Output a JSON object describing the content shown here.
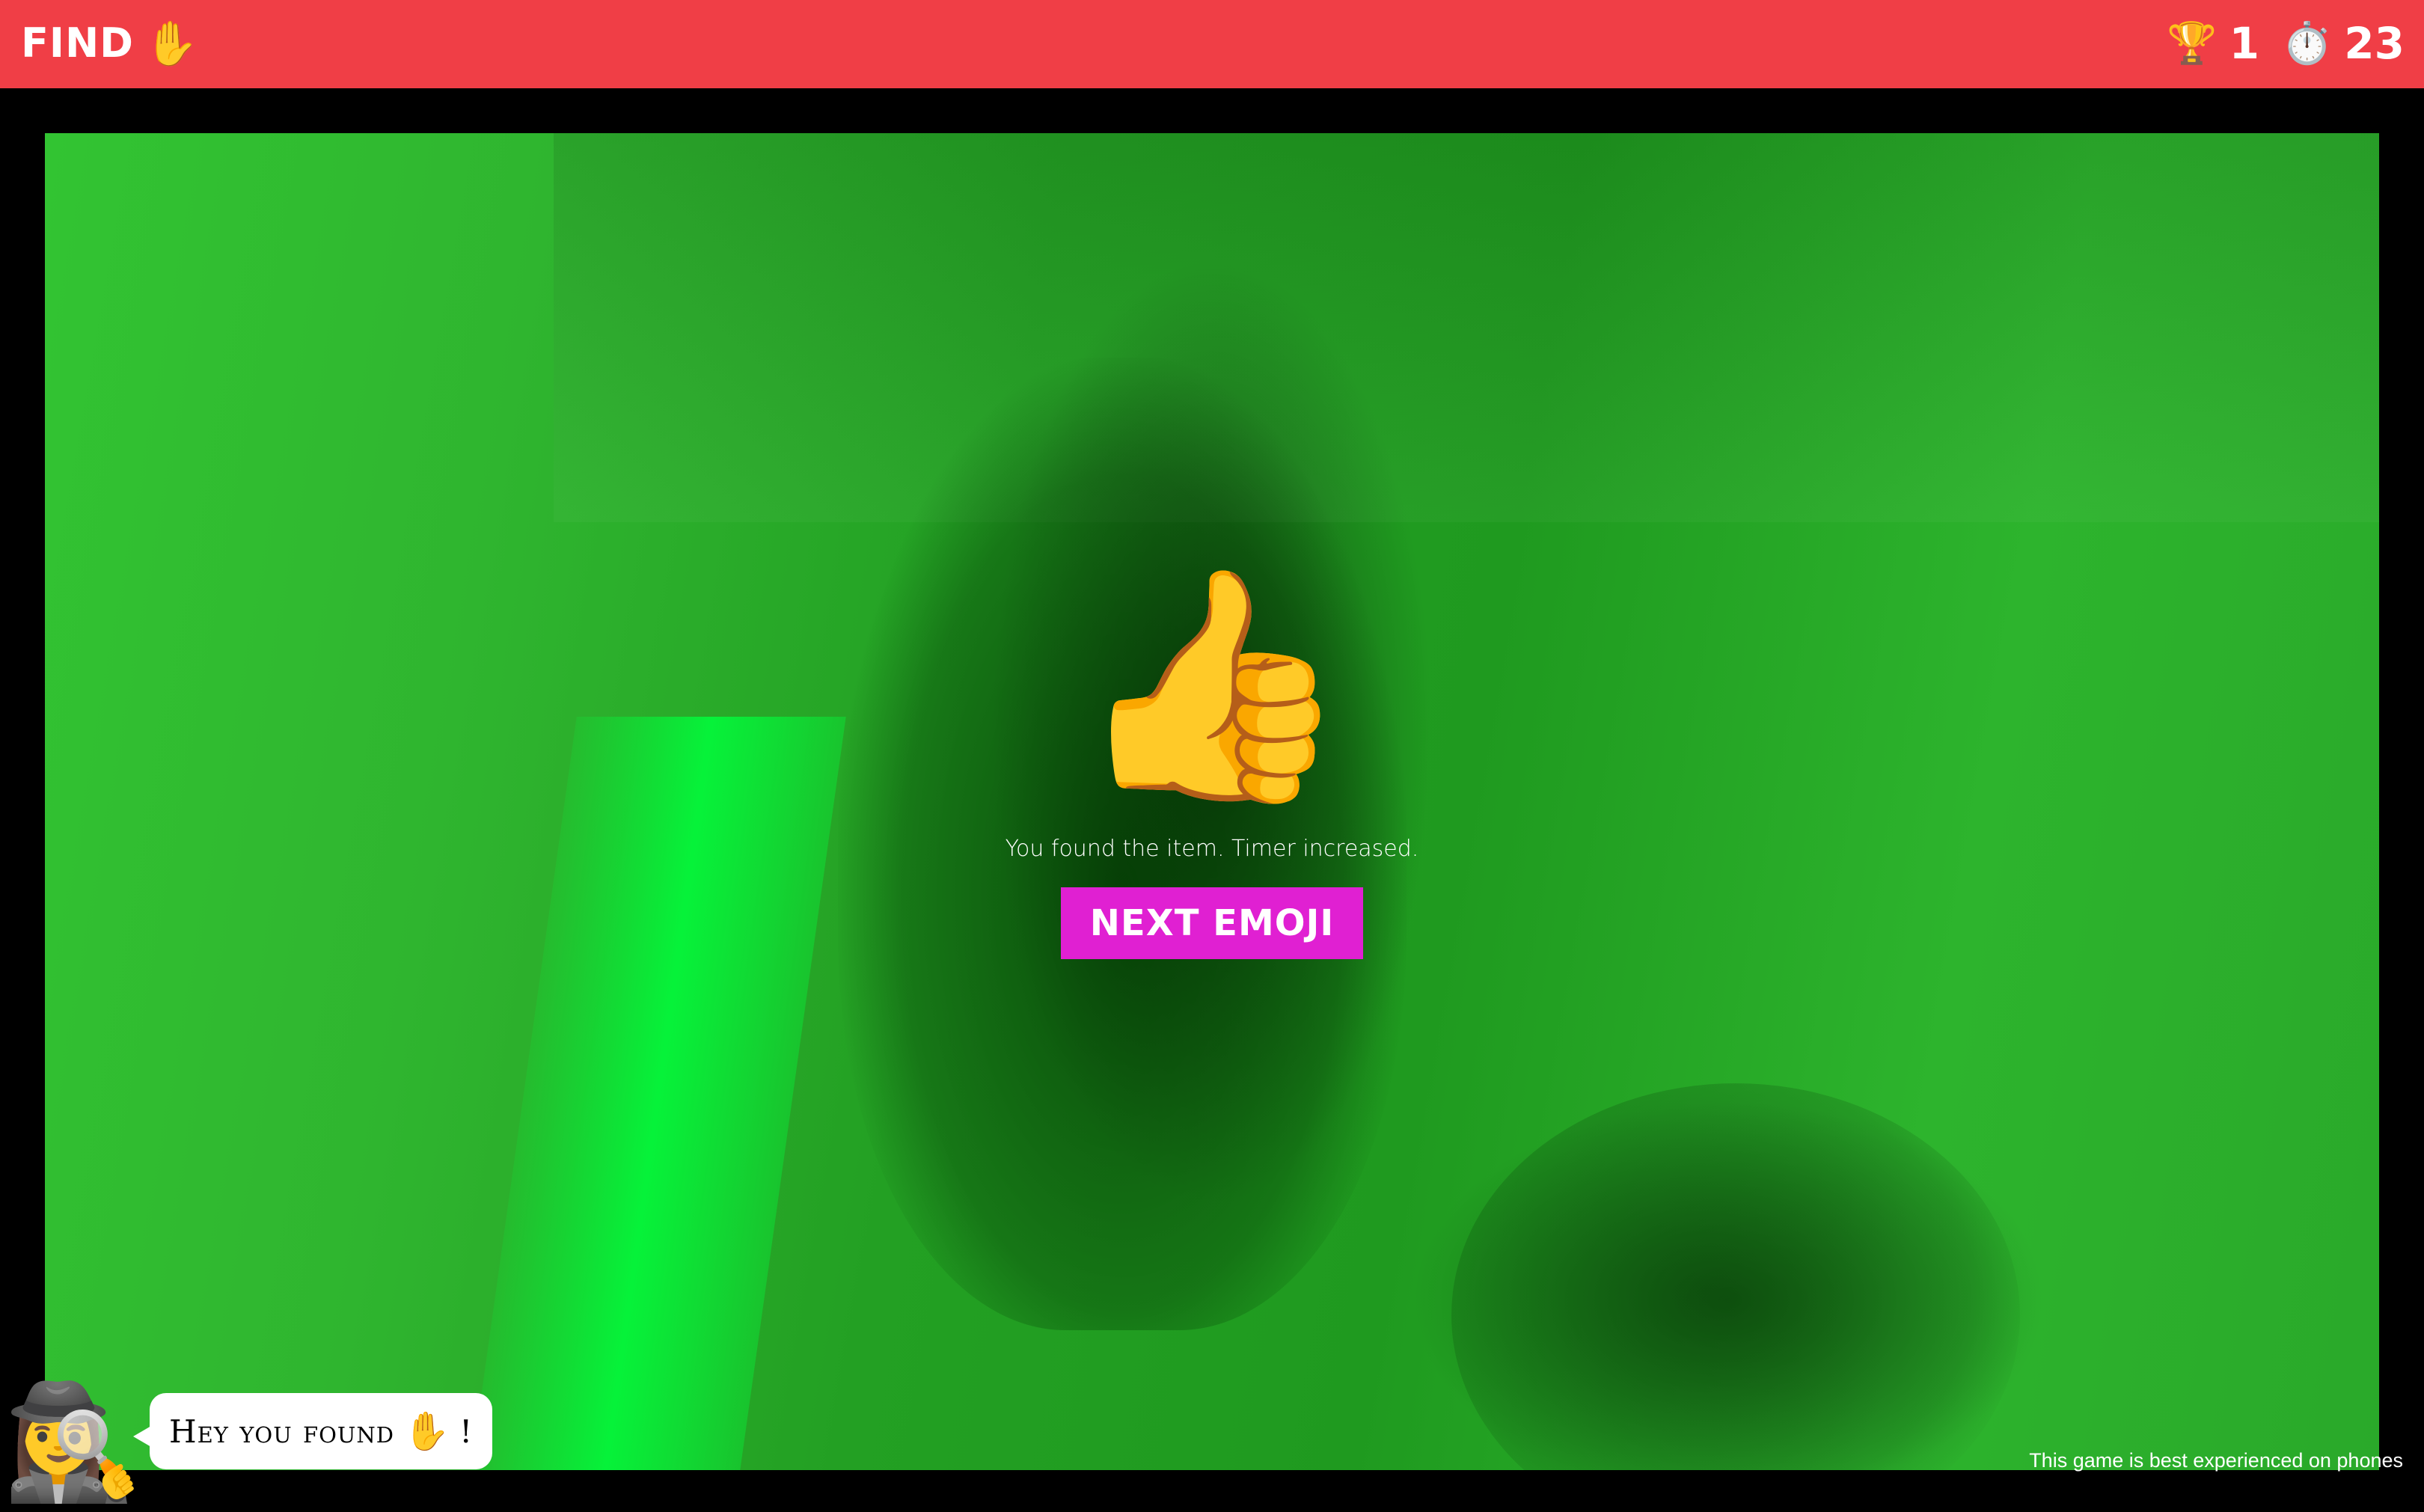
{
  "header": {
    "find_label": "FIND",
    "find_emoji": "✋",
    "trophy_icon": "🏆",
    "score": "1",
    "timer_icon": "⏱️",
    "time_left": "23",
    "background_color": "#f03e46"
  },
  "result": {
    "icon": "👍",
    "message": "You found the item. Timer increased.",
    "next_button_label": "NEXT EMOJI",
    "button_color": "#e020d2"
  },
  "mascot": {
    "icon": "🕵️‍♀️",
    "bubble_text": "Hey you found",
    "bubble_emoji": "✋",
    "bubble_suffix": "!"
  },
  "footer": {
    "note": "This game is best experienced on phones"
  }
}
